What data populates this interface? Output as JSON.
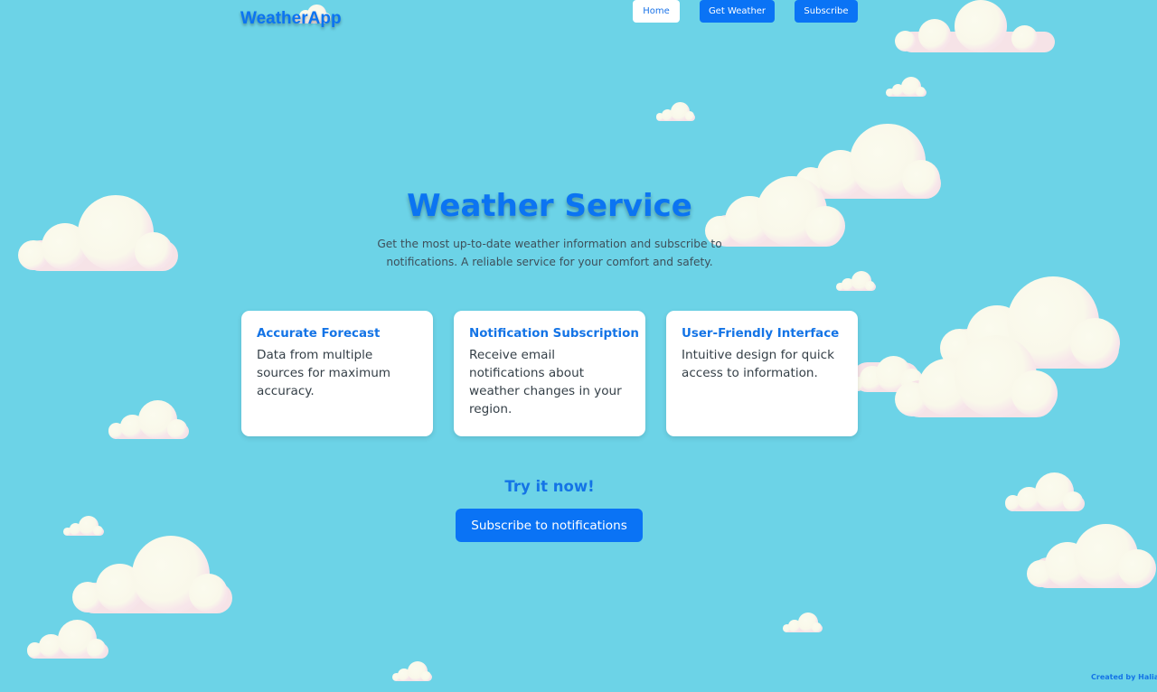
{
  "header": {
    "logo": "WeatherApp",
    "nav": [
      {
        "label": "Home"
      },
      {
        "label": "Get Weather"
      },
      {
        "label": "Subscribe"
      }
    ]
  },
  "hero": {
    "title": "Weather Service",
    "subtitle": "Get the most up-to-date weather information and subscribe to notifications. A reliable service for your comfort and safety."
  },
  "features": [
    {
      "title": "Accurate Forecast",
      "text": "Data from multiple sources for maximum accuracy."
    },
    {
      "title": "Notification Subscription",
      "text": "Receive email notifications about weather changes in your region."
    },
    {
      "title": "User-Friendly Interface",
      "text": "Intuitive design for quick access to information."
    }
  ],
  "cta": {
    "title": "Try it now!",
    "button": "Subscribe to notifications"
  },
  "footer": {
    "credit": "Created by Haliam"
  },
  "theme": {
    "background": "#6cd3e7",
    "accent": "#0a73f5",
    "card_background": "#ffffff",
    "cloud_icon": "cloud-icon"
  }
}
